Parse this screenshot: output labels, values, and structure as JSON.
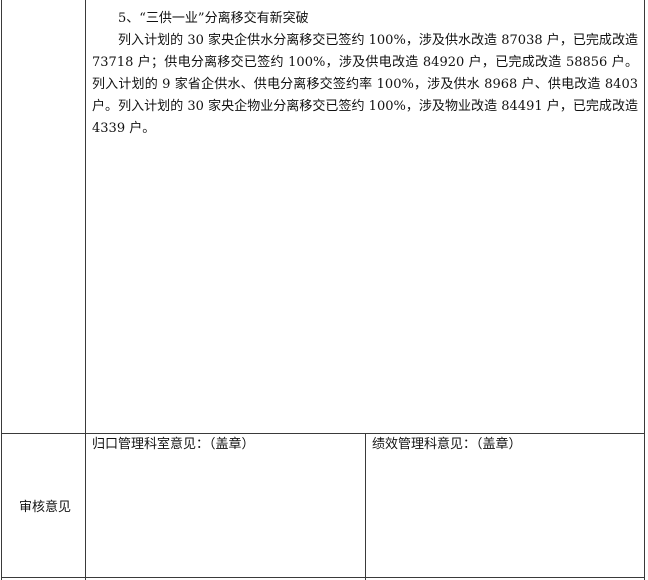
{
  "section": {
    "heading": "5、“三供一业”分离移交有新突破",
    "paragraph": "列入计划的 30 家央企供水分离移交已签约 100%，涉及供水改造 87038 户，已完成改造 73718 户；供电分离移交已签约 100%，涉及供电改造 84920 户，已完成改造 58856 户。列入计划的 9 家省企供水、供电分离移交签约率 100%，涉及供水 8968 户、供电改造 8403 户。列入计划的 30 家央企物业分离移交已签约 100%，涉及物业改造 84491 户，已完成改造 4339 户。"
  },
  "review": {
    "row_label": "审核意见",
    "left_label": "归口管理科室意见：（盖章）",
    "right_label": "绩效管理科意见：（盖章）"
  }
}
